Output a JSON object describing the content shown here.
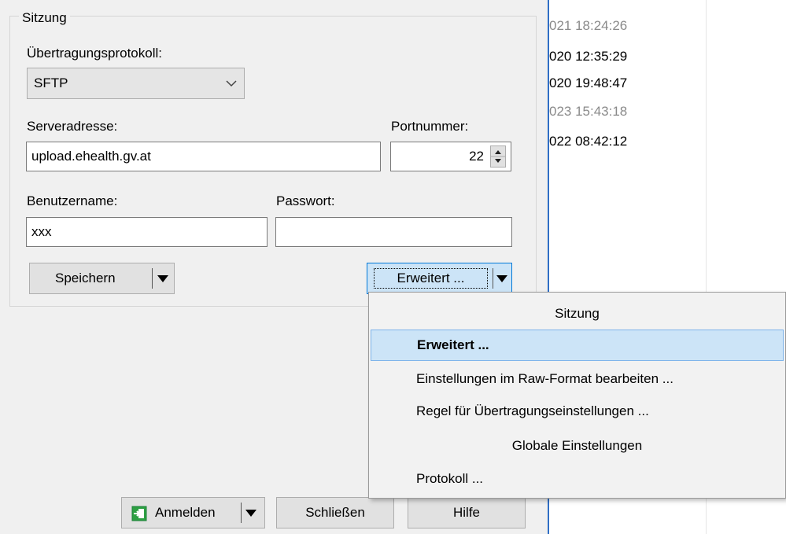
{
  "session": {
    "group_title": "Sitzung",
    "protocol_label": "Übertragungsprotokoll:",
    "protocol_value": "SFTP",
    "server_label": "Serveradresse:",
    "server_value": "upload.ehealth.gv.at",
    "port_label": "Portnummer:",
    "port_value": "22",
    "user_label": "Benutzername:",
    "user_value": "xxx",
    "password_label": "Passwort:",
    "password_value": "",
    "save_button": "Speichern",
    "advanced_button": "Erweitert ..."
  },
  "menu": {
    "header": "Sitzung",
    "items": [
      "Erweitert ...",
      "Einstellungen im Raw-Format bearbeiten ...",
      "Regel für Übertragungseinstellungen ..."
    ],
    "section2_header": "Globale Einstellungen",
    "section2_items": [
      "Protokoll ..."
    ]
  },
  "bottom": {
    "login_button": "Anmelden",
    "close_button": "Schließen",
    "help_button": "Hilfe"
  },
  "right_list": {
    "timestamps": [
      "021 18:24:26",
      "020 12:35:29",
      "020 19:48:47",
      "023 15:43:18",
      "022 08:42:12"
    ]
  },
  "colors": {
    "accent": "#2f6ec5",
    "menu_highlight": "#cce4f7",
    "menu_highlight_border": "#7eb4ea",
    "login_icon": "#2ea043"
  }
}
